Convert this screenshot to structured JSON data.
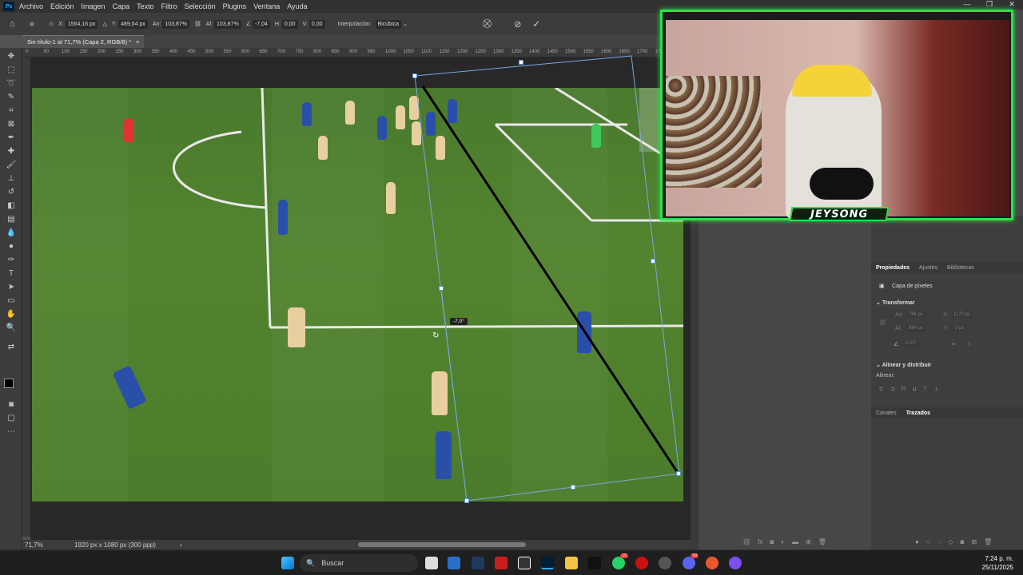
{
  "app": {
    "menu": [
      "Archivo",
      "Edición",
      "Imagen",
      "Capa",
      "Texto",
      "Filtro",
      "Selección",
      "Plugins",
      "Ventana",
      "Ayuda"
    ]
  },
  "options": {
    "x_label": "X:",
    "x_value": "1564,16 px",
    "y_label": "Y:",
    "y_value": "489,04 px",
    "w_label": "An:",
    "w_value": "103,87%",
    "h_label": "Al:",
    "h_value": "103,87%",
    "angle_value": "-7,04",
    "hskew_label": "H:",
    "hskew_value": "0,00",
    "vskew_label": "V:",
    "vskew_value": "0,00",
    "interp_label": "Interpolación:",
    "interp_value": "Bicúbica"
  },
  "document": {
    "tab_title": "Sin título-1 al 71,7% (Capa 2, RGB/8) *",
    "close": "×",
    "ruler_ticks": [
      "0",
      "50",
      "100",
      "150",
      "200",
      "250",
      "300",
      "350",
      "400",
      "450",
      "500",
      "550",
      "600",
      "650",
      "700",
      "750",
      "800",
      "850",
      "900",
      "950",
      "1000",
      "1050",
      "1100",
      "1150",
      "1200",
      "1250",
      "1300",
      "1350",
      "1400",
      "1450",
      "1500",
      "1550",
      "1600",
      "1650",
      "1700",
      "1750",
      "1800"
    ]
  },
  "canvas": {
    "rotation_readout": "-7,0°"
  },
  "status": {
    "zoom": "71,7%",
    "doc_size": "1920 px x 1080 px (300 ppp)"
  },
  "properties": {
    "tabs": [
      "Propiedades",
      "Ajustes",
      "Bibliotecas"
    ],
    "layer_type": "Capa de píxeles",
    "transform_title": "Transformar",
    "w_label": "An:",
    "w_val": "766 px",
    "x_label": "X:",
    "x_val": "1170 px",
    "h_label": "Al:",
    "h_val": "864 px",
    "y_label": "Y:",
    "y_val": "-3 px",
    "angle_val": "0,00°",
    "align_title": "Alinear y distribuir",
    "align_label": "Alinear:"
  },
  "paths_panel": {
    "tabs": [
      "Canales",
      "Trazados"
    ]
  },
  "webcam": {
    "name": "JEYSONG"
  },
  "taskbar": {
    "search_placeholder": "Buscar",
    "time": "7:24 p. m.",
    "date": "25/11/2025",
    "badge_whatsapp": "15",
    "badge_discord": "99"
  },
  "colors": {
    "accent_green": "#27e34a",
    "chelsea_blue": "#2a4fa8",
    "opponent_kit": "#e8cfa0",
    "pitch": "#4f802d"
  }
}
